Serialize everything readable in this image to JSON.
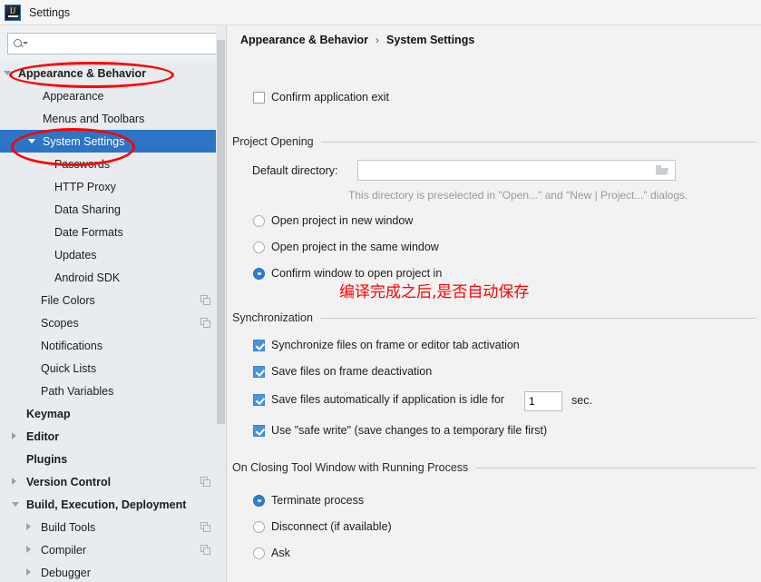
{
  "window": {
    "title": "Settings",
    "icon": "intellij-idea-icon",
    "icon_text": "IJ"
  },
  "sidebar": {
    "search": {
      "value": "",
      "placeholder": "",
      "icon": "search-icon"
    },
    "items": [
      {
        "label": "Appearance & Behavior",
        "indent": 20,
        "bold": true,
        "arrow": "down",
        "selected": false,
        "copy": false
      },
      {
        "label": "Appearance",
        "indent": 47,
        "bold": false,
        "arrow": "none",
        "selected": false,
        "copy": false
      },
      {
        "label": "Menus and Toolbars",
        "indent": 47,
        "bold": false,
        "arrow": "none",
        "selected": false,
        "copy": false
      },
      {
        "label": "System Settings",
        "indent": 47,
        "bold": false,
        "arrow": "down",
        "selected": true,
        "copy": false
      },
      {
        "label": "Passwords",
        "indent": 60,
        "bold": false,
        "arrow": "none",
        "selected": false,
        "copy": false
      },
      {
        "label": "HTTP Proxy",
        "indent": 60,
        "bold": false,
        "arrow": "none",
        "selected": false,
        "copy": false
      },
      {
        "label": "Data Sharing",
        "indent": 60,
        "bold": false,
        "arrow": "none",
        "selected": false,
        "copy": false
      },
      {
        "label": "Date Formats",
        "indent": 60,
        "bold": false,
        "arrow": "none",
        "selected": false,
        "copy": false
      },
      {
        "label": "Updates",
        "indent": 60,
        "bold": false,
        "arrow": "none",
        "selected": false,
        "copy": false
      },
      {
        "label": "Android SDK",
        "indent": 60,
        "bold": false,
        "arrow": "none",
        "selected": false,
        "copy": false
      },
      {
        "label": "File Colors",
        "indent": 45,
        "bold": false,
        "arrow": "none",
        "selected": false,
        "copy": true
      },
      {
        "label": "Scopes",
        "indent": 45,
        "bold": false,
        "arrow": "none",
        "selected": false,
        "copy": true
      },
      {
        "label": "Notifications",
        "indent": 45,
        "bold": false,
        "arrow": "none",
        "selected": false,
        "copy": false
      },
      {
        "label": "Quick Lists",
        "indent": 45,
        "bold": false,
        "arrow": "none",
        "selected": false,
        "copy": false
      },
      {
        "label": "Path Variables",
        "indent": 45,
        "bold": false,
        "arrow": "none",
        "selected": false,
        "copy": false
      },
      {
        "label": "Keymap",
        "indent": 29,
        "bold": true,
        "arrow": "none",
        "selected": false,
        "copy": false
      },
      {
        "label": "Editor",
        "indent": 29,
        "bold": true,
        "arrow": "right",
        "selected": false,
        "copy": false
      },
      {
        "label": "Plugins",
        "indent": 29,
        "bold": true,
        "arrow": "none",
        "selected": false,
        "copy": false
      },
      {
        "label": "Version Control",
        "indent": 29,
        "bold": true,
        "arrow": "right",
        "selected": false,
        "copy": true
      },
      {
        "label": "Build, Execution, Deployment",
        "indent": 29,
        "bold": true,
        "arrow": "down",
        "selected": false,
        "copy": false
      },
      {
        "label": "Build Tools",
        "indent": 45,
        "bold": false,
        "arrow": "right",
        "selected": false,
        "copy": true
      },
      {
        "label": "Compiler",
        "indent": 45,
        "bold": false,
        "arrow": "right",
        "selected": false,
        "copy": true
      },
      {
        "label": "Debugger",
        "indent": 45,
        "bold": false,
        "arrow": "right",
        "selected": false,
        "copy": false
      }
    ]
  },
  "panel": {
    "breadcrumb": {
      "parent": "Appearance & Behavior",
      "separator": "›",
      "current": "System Settings"
    },
    "confirm_exit": {
      "label": "Confirm application exit",
      "checked": false
    },
    "project_opening": {
      "title": "Project Opening",
      "default_directory_label": "Default directory:",
      "default_directory_value": "",
      "default_directory_placeholder": "",
      "browse_icon": "folder-icon",
      "hint": "This directory is preselected in \"Open...\" and \"New | Project...\" dialogs.",
      "options": [
        {
          "label": "Open project in new window",
          "selected": false
        },
        {
          "label": "Open project in the same window",
          "selected": false
        },
        {
          "label": "Confirm window to open project in",
          "selected": true
        }
      ]
    },
    "synchronization": {
      "title": "Synchronization",
      "checkboxes": [
        {
          "label": "Synchronize files on frame or editor tab activation",
          "checked": true
        },
        {
          "label": "Save files on frame deactivation",
          "checked": true
        },
        {
          "label": "Save files automatically if application is idle for",
          "checked": true
        },
        {
          "label": "Use \"safe write\" (save changes to a temporary file first)",
          "checked": true
        }
      ],
      "idle_seconds_value": "1",
      "idle_seconds_unit": "sec."
    },
    "closing_tool_window": {
      "title": "On Closing Tool Window with Running Process",
      "options": [
        {
          "label": "Terminate process",
          "selected": true
        },
        {
          "label": "Disconnect (if available)",
          "selected": false
        },
        {
          "label": "Ask",
          "selected": false
        }
      ]
    }
  },
  "annotations": {
    "note_text": "编译完成之后,是否自动保存",
    "note_color": "#ff0000",
    "highlight_color": "#ff0000"
  }
}
